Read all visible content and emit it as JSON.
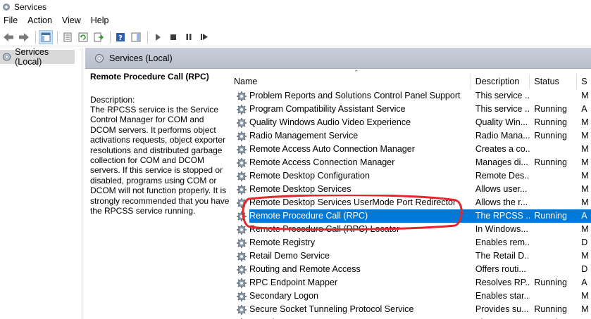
{
  "window": {
    "title": "Services"
  },
  "menu": [
    "File",
    "Action",
    "View",
    "Help"
  ],
  "toolbar": {
    "icons": [
      "back-arrow-icon",
      "forward-arrow-icon",
      "show-hide-console-tree-icon",
      "properties-icon",
      "refresh-icon",
      "export-list-icon",
      "help-icon",
      "action-pane-icon",
      "start-icon",
      "stop-icon",
      "pause-icon",
      "restart-icon"
    ]
  },
  "tree": {
    "root_label": "Services (Local)"
  },
  "header": {
    "label": "Services (Local)"
  },
  "details": {
    "title": "Remote Procedure Call (RPC)",
    "description_label": "Description:",
    "description": "The RPCSS service is the Service Control Manager for COM and DCOM servers. It performs object activations requests, object exporter resolutions and distributed garbage collection for COM and DCOM servers. If this service is stopped or disabled, programs using COM or DCOM will not function properly. It is strongly recommended that you have the RPCSS service running."
  },
  "columns": {
    "name": "Name",
    "description": "Description",
    "status": "Status",
    "startup": "S"
  },
  "services": [
    {
      "name": "Problem Reports and Solutions Control Panel Support",
      "description": "This service ...",
      "status": "",
      "startup": "M"
    },
    {
      "name": "Program Compatibility Assistant Service",
      "description": "This service ...",
      "status": "Running",
      "startup": "A"
    },
    {
      "name": "Quality Windows Audio Video Experience",
      "description": "Quality Win...",
      "status": "Running",
      "startup": "M"
    },
    {
      "name": "Radio Management Service",
      "description": "Radio Mana...",
      "status": "Running",
      "startup": "M"
    },
    {
      "name": "Remote Access Auto Connection Manager",
      "description": "Creates a co...",
      "status": "",
      "startup": "M"
    },
    {
      "name": "Remote Access Connection Manager",
      "description": "Manages di...",
      "status": "Running",
      "startup": "M"
    },
    {
      "name": "Remote Desktop Configuration",
      "description": "Remote Des...",
      "status": "",
      "startup": "M"
    },
    {
      "name": "Remote Desktop Services",
      "description": "Allows user...",
      "status": "",
      "startup": "M"
    },
    {
      "name": "Remote Desktop Services UserMode Port Redirector",
      "description": "Allows the r...",
      "status": "",
      "startup": "M"
    },
    {
      "name": "Remote Procedure Call (RPC)",
      "description": "The RPCSS ...",
      "status": "Running",
      "startup": "A",
      "selected": true
    },
    {
      "name": "Remote Procedure Call (RPC) Locator",
      "description": "In Windows...",
      "status": "",
      "startup": "M"
    },
    {
      "name": "Remote Registry",
      "description": "Enables rem...",
      "status": "",
      "startup": "D"
    },
    {
      "name": "Retail Demo Service",
      "description": "The Retail D...",
      "status": "",
      "startup": "M"
    },
    {
      "name": "Routing and Remote Access",
      "description": "Offers routi...",
      "status": "",
      "startup": "D"
    },
    {
      "name": "RPC Endpoint Mapper",
      "description": "Resolves RP...",
      "status": "Running",
      "startup": "A"
    },
    {
      "name": "Secondary Logon",
      "description": "Enables star...",
      "status": "",
      "startup": "M"
    },
    {
      "name": "Secure Socket Tunneling Protocol Service",
      "description": "Provides su...",
      "status": "Running",
      "startup": "M"
    },
    {
      "name": "Security Accounts Manager",
      "description": "The startup...",
      "status": "Running",
      "startup": "A"
    }
  ],
  "colors": {
    "selection": "#0078d7",
    "annotation": "#e0282d",
    "header_bg": "#bfc6d2"
  }
}
